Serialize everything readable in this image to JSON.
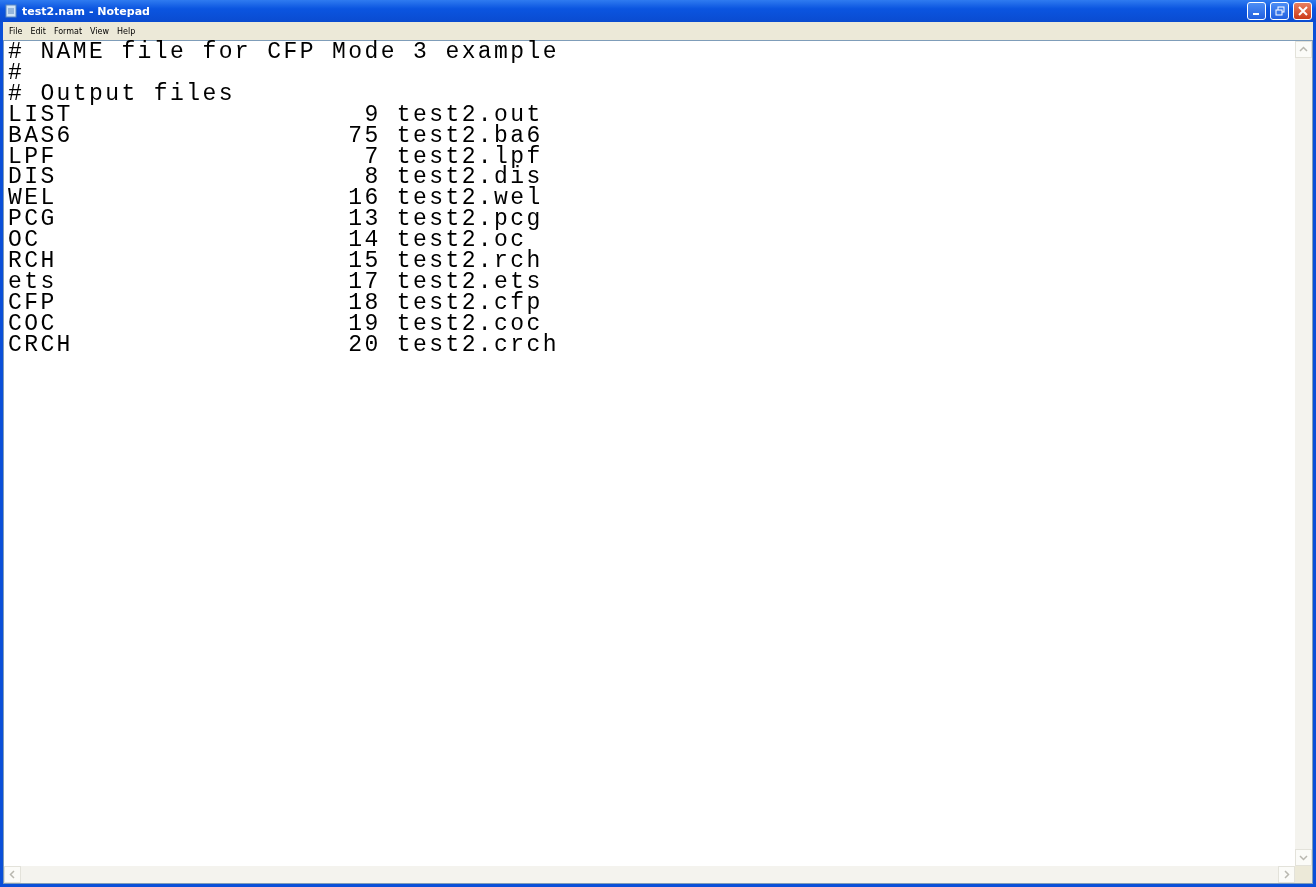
{
  "window": {
    "title": "test2.nam - Notepad"
  },
  "menu": [
    "File",
    "Edit",
    "Format",
    "View",
    "Help"
  ],
  "lines": [
    "# NAME file for CFP Mode 3 example",
    "#",
    "# Output files",
    "LIST                  9 test2.out",
    "BAS6                 75 test2.ba6",
    "LPF                   7 test2.lpf",
    "DIS                   8 test2.dis",
    "WEL                  16 test2.wel",
    "PCG                  13 test2.pcg",
    "OC                   14 test2.oc",
    "RCH                  15 test2.rch",
    "ets                  17 test2.ets",
    "CFP                  18 test2.cfp",
    "COC                  19 test2.coc",
    "CRCH                 20 test2.crch"
  ]
}
